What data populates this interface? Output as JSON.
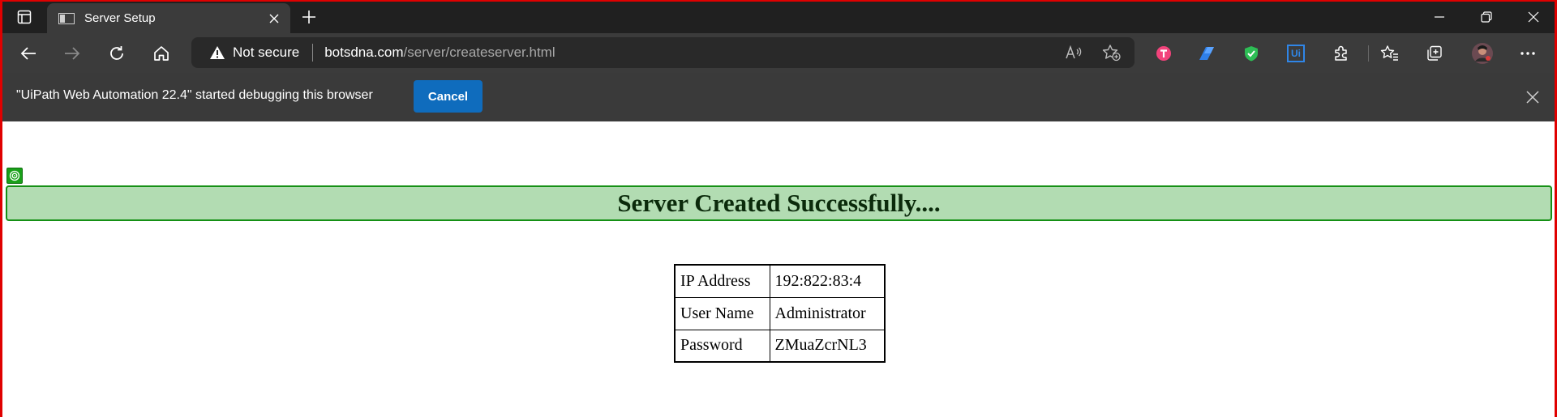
{
  "browser": {
    "tab": {
      "title": "Server Setup"
    },
    "address_bar": {
      "security_label": "Not secure",
      "url_host": "botsdna.com",
      "url_path": "/server/createserver.html"
    },
    "toolbar_icons": [
      "back-icon",
      "forward-icon",
      "refresh-icon",
      "home-icon",
      "read-aloud-icon",
      "add-favorite-icon",
      "extension-t-icon",
      "extension-power-automate-icon",
      "extension-shield-icon",
      "extension-uipath-icon",
      "extensions-puzzle-icon",
      "favorites-icon",
      "collections-icon",
      "profile-avatar",
      "more-menu-icon"
    ],
    "uipath_ext_label": "Ui"
  },
  "infobar": {
    "message": "\"UiPath Web Automation 22.4\" started debugging this browser",
    "cancel_label": "Cancel"
  },
  "page": {
    "banner": "Server Created Successfully....",
    "table": [
      {
        "key": "IP Address",
        "value": "192:822:83:4"
      },
      {
        "key": "User Name",
        "value": "Administrator"
      },
      {
        "key": "Password",
        "value": "ZMuaZcrNL3"
      }
    ]
  },
  "colors": {
    "accent_blue": "#0f6cbd",
    "banner_bg": "#b2dcb2",
    "banner_border": "#159015",
    "frame_red": "#e00000"
  }
}
